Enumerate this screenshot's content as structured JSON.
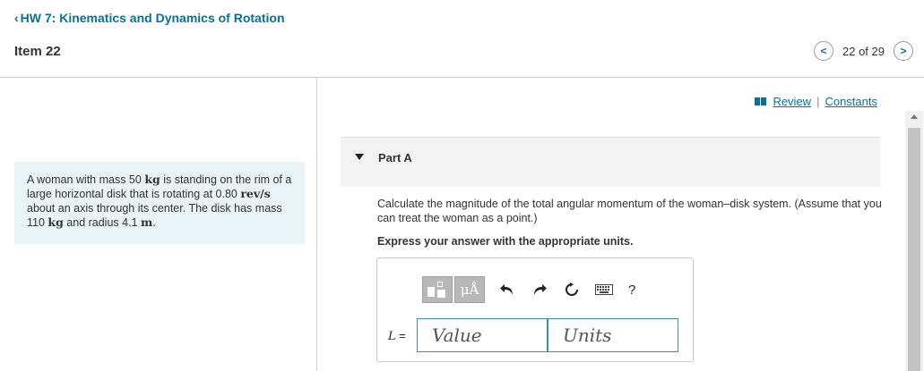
{
  "nav": {
    "back_label": "HW 7: Kinematics and Dynamics of Rotation"
  },
  "item": {
    "title": "Item 22"
  },
  "pager": {
    "text": "22 of 29",
    "prev": "<",
    "next": ">"
  },
  "links": {
    "review": "Review",
    "separator": "|",
    "constants": "Constants"
  },
  "problem": {
    "t1": "A woman with mass 50 ",
    "kg": "kg",
    "t2": " is standing on the rim of a large horizontal disk that is rotating at 0.80 ",
    "revs": "rev/s",
    "t3": " about an axis through its center. The disk has mass 110 ",
    "kg2": "kg",
    "t4": " and radius 4.1 ",
    "m": "m",
    "t5": "."
  },
  "part": {
    "label": "Part A",
    "question": "Calculate the magnitude of the total angular momentum of the woman–disk system. (Assume that you can treat the woman as a point.)",
    "instruction": "Express your answer with the appropriate units."
  },
  "answer": {
    "units_button": "μÅ",
    "help": "?",
    "variable": "L",
    "equals": " =",
    "value_placeholder": "Value",
    "units_placeholder": "Units"
  },
  "icons": {
    "back": "chevron-left-icon",
    "book": "book-icon",
    "templates": "templates-icon",
    "undo": "undo-icon",
    "redo": "redo-icon",
    "reset": "reset-icon",
    "keyboard": "keyboard-icon"
  },
  "colors": {
    "link": "#0b6e99",
    "panel": "#eaf4f6",
    "input_border": "#3a8fa3"
  }
}
